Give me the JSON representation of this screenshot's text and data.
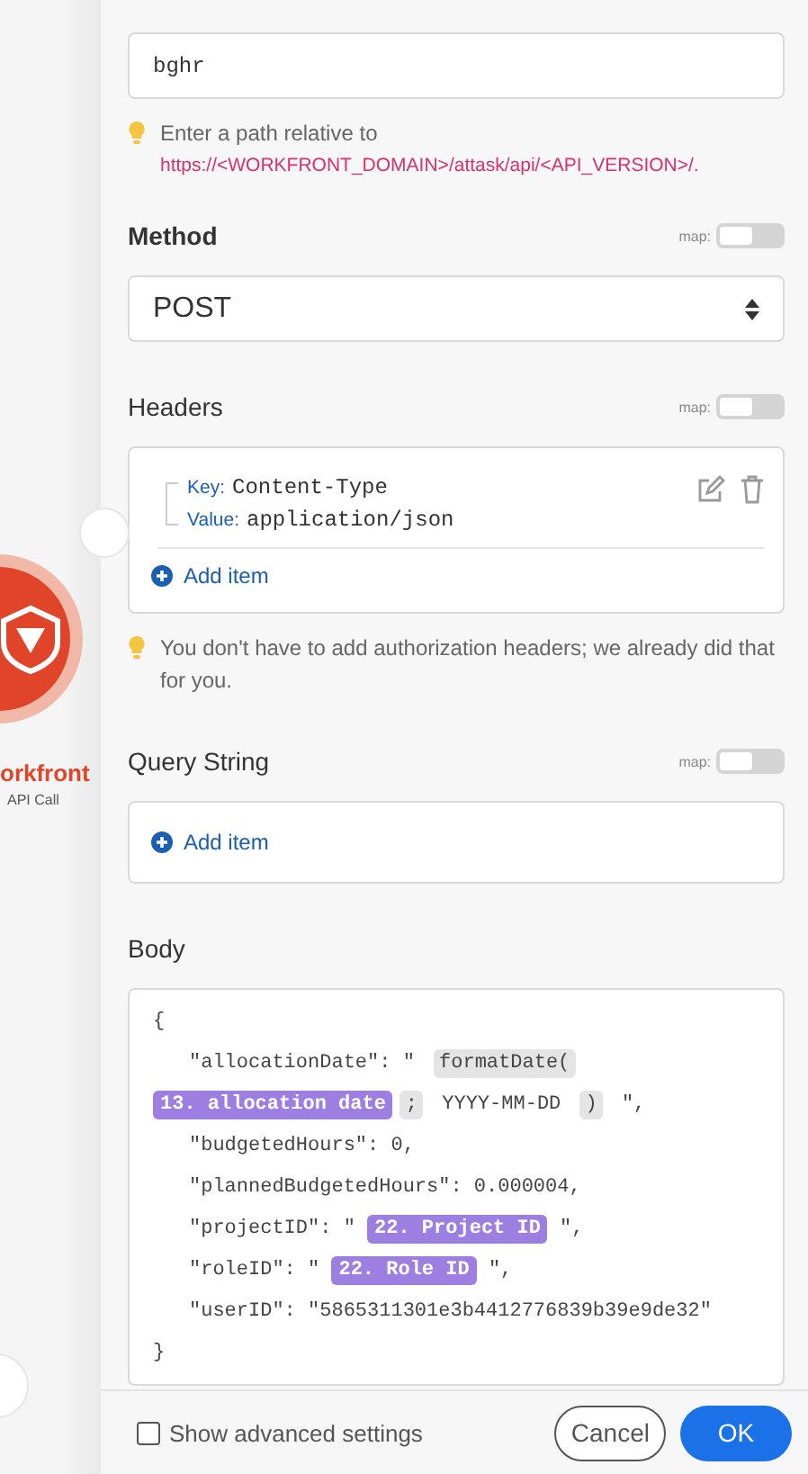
{
  "canvas": {
    "module": {
      "name": "orkfront",
      "subtitle": "API Call"
    }
  },
  "url_field": {
    "value": "bghr"
  },
  "url_hint": {
    "text": "Enter a path relative to",
    "link": "https://<WORKFRONT_DOMAIN>/attask/api/<API_VERSION>/."
  },
  "method": {
    "label": "Method",
    "map_label": "map:",
    "map_on": false,
    "value": "POST"
  },
  "headers": {
    "label": "Headers",
    "map_label": "map:",
    "map_on": false,
    "items": [
      {
        "key_label": "Key:",
        "key": "Content-Type",
        "value_label": "Value:",
        "value": "application/json"
      }
    ],
    "add_label": "Add item",
    "hint": "You don't have to add authorization headers; we already did that for you."
  },
  "query_string": {
    "label": "Query String",
    "map_label": "map:",
    "map_on": false,
    "add_label": "Add item"
  },
  "body": {
    "label": "Body",
    "lines": [
      {
        "indent": false,
        "segments": [
          {
            "kind": "text",
            "text": "{"
          }
        ]
      },
      {
        "indent": true,
        "segments": [
          {
            "kind": "text",
            "text": "\"allocationDate\": \" "
          },
          {
            "kind": "function",
            "text": "formatDate("
          }
        ]
      },
      {
        "indent": false,
        "segments": [
          {
            "kind": "variable",
            "text": "13. allocation date"
          },
          {
            "kind": "function",
            "text": ";"
          },
          {
            "kind": "text",
            "text": " YYYY-MM-DD "
          },
          {
            "kind": "function",
            "text": ")"
          },
          {
            "kind": "text",
            "text": " \","
          }
        ]
      },
      {
        "indent": true,
        "segments": [
          {
            "kind": "text",
            "text": "\"budgetedHours\": 0,"
          }
        ]
      },
      {
        "indent": true,
        "segments": [
          {
            "kind": "text",
            "text": "\"plannedBudgetedHours\": 0.000004,"
          }
        ]
      },
      {
        "indent": true,
        "segments": [
          {
            "kind": "text",
            "text": "\"projectID\": \" "
          },
          {
            "kind": "variable",
            "text": "22. Project ID"
          },
          {
            "kind": "text",
            "text": " \","
          }
        ]
      },
      {
        "indent": true,
        "segments": [
          {
            "kind": "text",
            "text": "\"roleID\": \" "
          },
          {
            "kind": "variable",
            "text": "22. Role ID"
          },
          {
            "kind": "text",
            "text": " \","
          }
        ]
      },
      {
        "indent": true,
        "segments": [
          {
            "kind": "text",
            "text": "\"userID\": \"5865311301e3b4412776839b39e9de32\""
          }
        ]
      },
      {
        "indent": false,
        "segments": [
          {
            "kind": "text",
            "text": "}"
          }
        ]
      }
    ]
  },
  "footer": {
    "advanced_label": "Show advanced settings",
    "advanced_checked": false,
    "cancel": "Cancel",
    "ok": "OK"
  }
}
